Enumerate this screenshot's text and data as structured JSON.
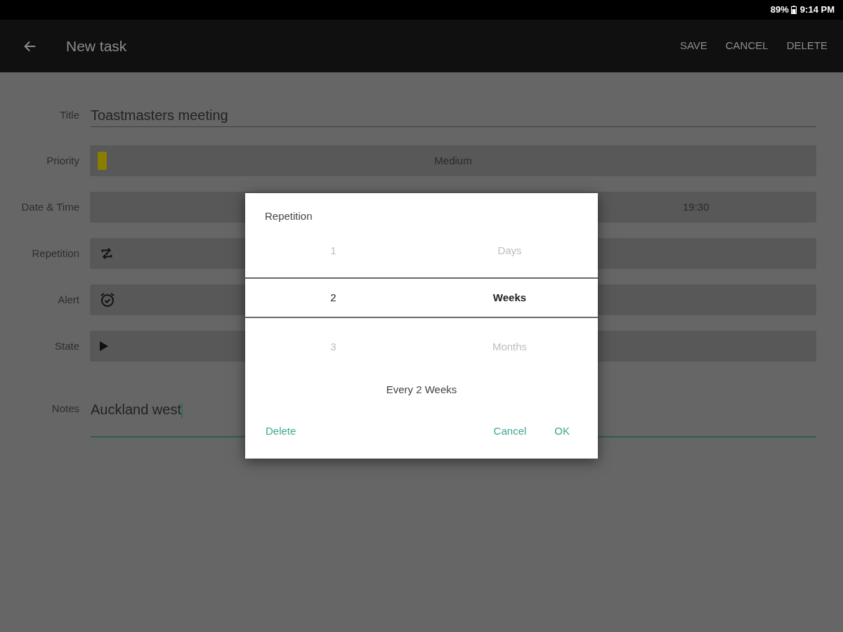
{
  "status_bar": {
    "battery": "89%",
    "time": "9:14 PM"
  },
  "app_bar": {
    "title": "New task",
    "actions": [
      "SAVE",
      "CANCEL",
      "DELETE"
    ]
  },
  "form": {
    "fields": [
      {
        "kind": "text",
        "label": "Title",
        "value": "Toastmasters meeting"
      },
      {
        "kind": "priority",
        "label": "Priority",
        "value": "Medium",
        "color": "#8a7d00"
      },
      {
        "kind": "datetime",
        "label": "Date & Time",
        "value": "19:30"
      },
      {
        "kind": "repetition",
        "label": "Repetition"
      },
      {
        "kind": "alert",
        "label": "Alert"
      },
      {
        "kind": "state",
        "label": "State"
      },
      {
        "kind": "notes",
        "label": "Notes",
        "value": "Auckland west",
        "focused": true
      }
    ]
  },
  "dialog": {
    "title": "Repetition",
    "numbers": [
      {
        "label": "1",
        "selected": false
      },
      {
        "label": "2",
        "selected": true
      },
      {
        "label": "3",
        "selected": false
      }
    ],
    "units": [
      {
        "label": "Days",
        "selected": false
      },
      {
        "label": "Weeks",
        "selected": true
      },
      {
        "label": "Months",
        "selected": false
      }
    ],
    "summary": "Every 2 Weeks",
    "delete_button": "Delete",
    "buttons": [
      "Cancel",
      "OK"
    ]
  }
}
